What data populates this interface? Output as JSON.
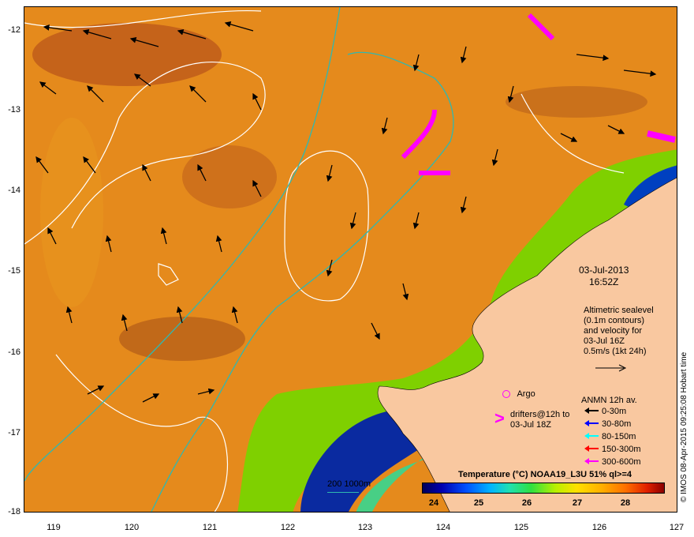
{
  "map": {
    "lat_ticks": [
      "-12",
      "-13",
      "-14",
      "-15",
      "-16",
      "-17",
      "-18"
    ],
    "lon_ticks": [
      "119",
      "120",
      "121",
      "122",
      "123",
      "124",
      "125",
      "126",
      "127"
    ],
    "lat_range": [
      -18,
      -11.85
    ],
    "lon_range": [
      118.65,
      127
    ],
    "land_color": "#f9c8a0",
    "ocean_warm_color": "#e07818",
    "contour_color": "#ffffff",
    "isobath_color": "#40c0c0",
    "argo_color": "#ff00ff"
  },
  "date_block": {
    "date": "03-Jul-2013",
    "time": "16:52Z"
  },
  "altimetric_note": {
    "line1": "Altimetric sealevel",
    "line2": "(0.1m contours)",
    "line3": "and velocity for",
    "line4": "03-Jul 16Z",
    "line5": "0.5m/s (1kt 24h)"
  },
  "argo": {
    "label": "Argo"
  },
  "drifters": {
    "line1": "drifters@12h to",
    "line2": "03-Jul 18Z",
    "symbol": ">"
  },
  "anmn": {
    "title": "ANMN 12h av.",
    "items": [
      {
        "label": "0-30m",
        "color": "#000000"
      },
      {
        "label": "30-80m",
        "color": "#0000ff"
      },
      {
        "label": "80-150m",
        "color": "#00ffff"
      },
      {
        "label": "150-300m",
        "color": "#ff0000"
      },
      {
        "label": "300-600m",
        "color": "#ff00ff"
      }
    ]
  },
  "isobath_legend": {
    "label": "200  1000m"
  },
  "colorbar": {
    "title": "Temperature (°C) NOAA19_L3U 51% ql>=4",
    "ticks": [
      "24",
      "25",
      "26",
      "27",
      "28"
    ]
  },
  "credit": "© IMOS 08-Apr-2015 09:25:08 Hobart time"
}
